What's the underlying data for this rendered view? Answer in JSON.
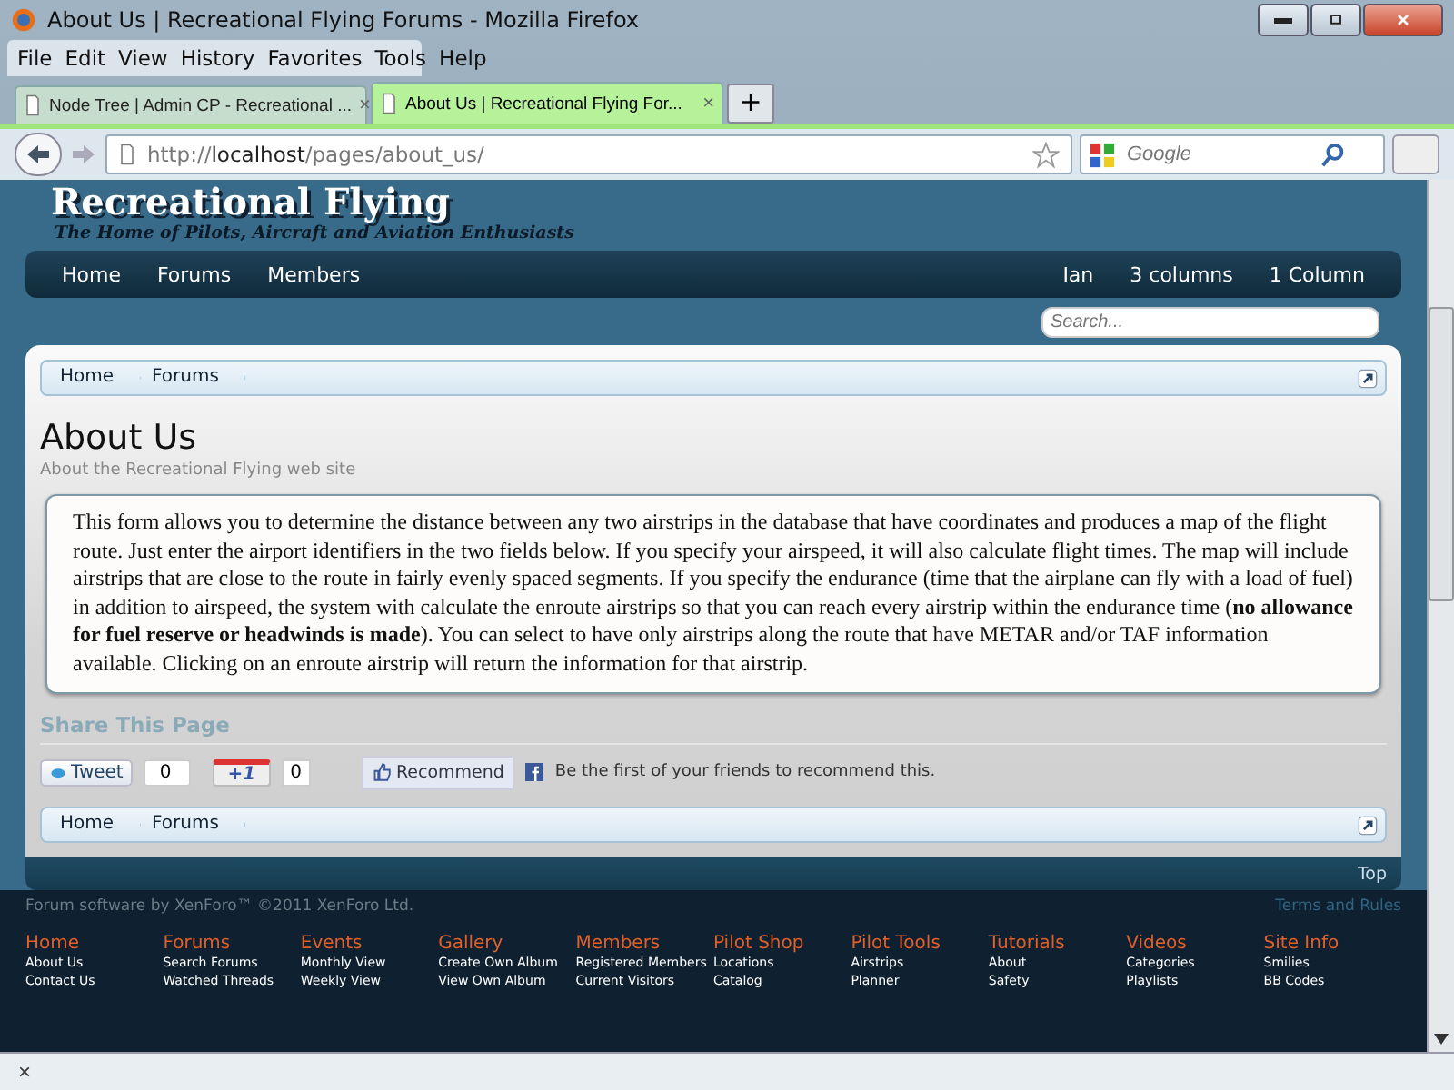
{
  "window": {
    "title": "About Us | Recreational Flying Forums - Mozilla Firefox"
  },
  "menu": [
    "File",
    "Edit",
    "View",
    "History",
    "Favorites",
    "Tools",
    "Help"
  ],
  "tabs": [
    {
      "label": "Node Tree | Admin CP - Recreational ...",
      "selected": false,
      "close": "×"
    },
    {
      "label": "About Us | Recreational Flying For...",
      "selected": true,
      "close": "×"
    }
  ],
  "new_tab": "+",
  "address": {
    "scheme": "http://",
    "host": "localhost",
    "path": "/pages/about_us/"
  },
  "web_search": {
    "placeholder": "Google"
  },
  "site": {
    "logo": "Recreational Flying",
    "tagline": "The Home of Pilots, Aircraft and Aviation Enthusiasts",
    "nav_left": [
      "Home",
      "Forums",
      "Members"
    ],
    "nav_right": [
      "Ian",
      "3 columns",
      "1 Column"
    ],
    "search": {
      "placeholder": "Search..."
    },
    "breadcrumbs_top": [
      "Home",
      "Forums"
    ],
    "title": "About Us",
    "description": "About the Recreational Flying web site",
    "body": "This form allows you to determine the distance between any two airstrips in the database that have coordinates and produces a map of the flight route. Just enter the airport identifiers in the two fields below. If you specify your airspeed, it will also calculate flight times. The map will include airstrips that are close to the route in fairly evenly spaced segments. If you specify the endurance (time that the airplane can fly with a load of fuel) in addition to airspeed, the system with calculate the enroute airstrips so that you can reach every airstrip within the endurance time (**no allowance for fuel reserve or headwinds is made**). You can select to have only airstrips along the route that have METAR and/or TAF information available. Clicking on an enroute airstrip will return the information for that airstrip.",
    "share": {
      "heading": "Share This Page",
      "tweet": "Tweet",
      "tweet_count": "0",
      "plus_one": "+1",
      "plus_one_count": "0",
      "recommend": "Recommend",
      "recommend_text": "Be the first of your friends to recommend this."
    },
    "breadcrumbs_bottom": [
      "Home",
      "Forums"
    ],
    "top_link": "Top",
    "copyright": "Forum software by XenForo™ ©2011 XenForo Ltd.",
    "terms": "Terms and Rules",
    "footer_columns": [
      {
        "heading": "Home",
        "links": [
          "About Us",
          "Contact Us"
        ]
      },
      {
        "heading": "Forums",
        "links": [
          "Search Forums",
          "Watched Threads"
        ]
      },
      {
        "heading": "Events",
        "links": [
          "Monthly View",
          "Weekly View"
        ]
      },
      {
        "heading": "Gallery",
        "links": [
          "Create Own Album",
          "View Own Album"
        ]
      },
      {
        "heading": "Members",
        "links": [
          "Registered Members",
          "Current Visitors"
        ]
      },
      {
        "heading": "Pilot Shop",
        "links": [
          "Locations",
          "Catalog"
        ]
      },
      {
        "heading": "Pilot Tools",
        "links": [
          "Airstrips",
          "Planner"
        ]
      },
      {
        "heading": "Tutorials",
        "links": [
          "About",
          "Safety"
        ]
      },
      {
        "heading": "Videos",
        "links": [
          "Categories",
          "Playlists"
        ]
      },
      {
        "heading": "Site Info",
        "links": [
          "Smilies",
          "BB Codes"
        ]
      }
    ]
  },
  "find_bar": {
    "close": "×"
  }
}
